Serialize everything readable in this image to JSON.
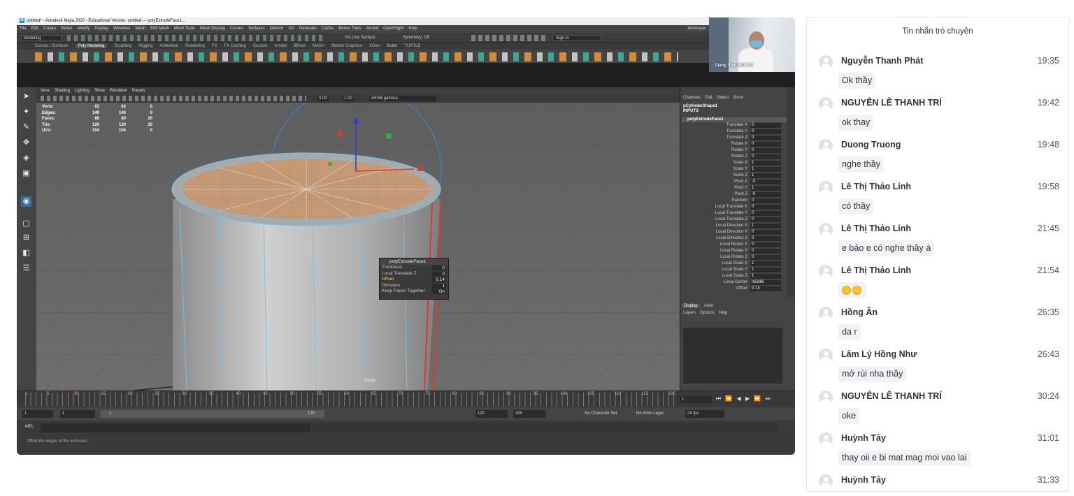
{
  "maya": {
    "title": "untitled* - Autodesk Maya 2020 - Educational Version: untitled  ---  polyExtrudeFace1...",
    "menus": [
      "File",
      "Edit",
      "Create",
      "Select",
      "Modify",
      "Display",
      "Windows",
      "Mesh",
      "Edit Mesh",
      "Mesh Tools",
      "Mesh Display",
      "Curves",
      "Surfaces",
      "Deform",
      "UV",
      "Generate",
      "Cache",
      "Bonus Tools",
      "Arnold",
      "OpenFlight",
      "Help"
    ],
    "workspace_label": "Workspac",
    "mode": "Modeling",
    "no_live_surface": "No Live Surface",
    "symmetry": "Symmetry: Off",
    "sign_in": "Sign In",
    "shelf_tabs": [
      "Curves / Surfaces",
      "Poly Modeling",
      "Sculpting",
      "Rigging",
      "Animation",
      "Rendering",
      "FX",
      "FX Caching",
      "Custom",
      "Arnold",
      "Bifrost",
      "MASH",
      "Motion Graphics",
      "XGen",
      "Bullet",
      "TURTLE"
    ],
    "panel_menus": [
      "View",
      "Shading",
      "Lighting",
      "Show",
      "Renderer",
      "Panels"
    ],
    "exposure": "0.00",
    "gamma_value": "1.00",
    "color_space": "sRGB gamma",
    "hud": [
      {
        "label": "Verts:",
        "a": "62",
        "b": "62",
        "c": "0"
      },
      {
        "label": "Edges:",
        "a": "140",
        "b": "140",
        "c": "0"
      },
      {
        "label": "Faces:",
        "a": "80",
        "b": "80",
        "c": "20"
      },
      {
        "label": "Tris:",
        "a": "120",
        "b": "120",
        "c": "20"
      },
      {
        "label": "UVs:",
        "a": "104",
        "b": "104",
        "c": "0"
      }
    ],
    "camera": "persp",
    "tool_box": {
      "title": "polyExtrudeFace1",
      "rows": [
        {
          "label": "Thickness",
          "value": "0"
        },
        {
          "label": "Local Translate Z",
          "value": "0"
        },
        {
          "label": "Offset",
          "value": "0.14"
        },
        {
          "label": "Divisions",
          "value": "1"
        },
        {
          "label": "Keep Faces Together",
          "value": "On"
        }
      ]
    },
    "channel_box": {
      "menus": [
        "Channels",
        "Edit",
        "Object",
        "Show"
      ],
      "shape": "pCylinderShape1",
      "inputs_label": "INPUTS",
      "node": "polyExtrudeFace1",
      "attributes": [
        {
          "name": "Translate X",
          "value": "0"
        },
        {
          "name": "Translate Y",
          "value": "0"
        },
        {
          "name": "Translate Z",
          "value": "0"
        },
        {
          "name": "Rotate X",
          "value": "0"
        },
        {
          "name": "Rotate Y",
          "value": "0"
        },
        {
          "name": "Rotate Z",
          "value": "0"
        },
        {
          "name": "Scale X",
          "value": "1"
        },
        {
          "name": "Scale Y",
          "value": "1"
        },
        {
          "name": "Scale Z",
          "value": "1"
        },
        {
          "name": "Pivot X",
          "value": "-0"
        },
        {
          "name": "Pivot Y",
          "value": "1"
        },
        {
          "name": "Pivot Z",
          "value": "-0"
        },
        {
          "name": "Random",
          "value": "0"
        },
        {
          "name": "Local Translate X",
          "value": "0"
        },
        {
          "name": "Local Translate Y",
          "value": "0"
        },
        {
          "name": "Local Translate Z",
          "value": "0"
        },
        {
          "name": "Local Direction X",
          "value": "1"
        },
        {
          "name": "Local Direction Y",
          "value": "0"
        },
        {
          "name": "Local Direction Z",
          "value": "0"
        },
        {
          "name": "Local Rotate X",
          "value": "0"
        },
        {
          "name": "Local Rotate Y",
          "value": "0"
        },
        {
          "name": "Local Rotate Z",
          "value": "0"
        },
        {
          "name": "Local Scale X",
          "value": "1"
        },
        {
          "name": "Local Scale Y",
          "value": "1"
        },
        {
          "name": "Local Scale Z",
          "value": "1"
        },
        {
          "name": "Local Center",
          "value": "middle"
        },
        {
          "name": "Offset",
          "value": "0.14"
        }
      ],
      "layer_tabs": [
        "Display",
        "Anim"
      ],
      "layer_menus": [
        "Layers",
        "Options",
        "Help"
      ]
    },
    "timeline_ticks": [
      "1",
      "5",
      "10",
      "15",
      "20",
      "25",
      "30",
      "35",
      "40",
      "45",
      "50",
      "55",
      "60",
      "65",
      "70",
      "75",
      "80",
      "85",
      "90",
      "95",
      "100",
      "105",
      "110",
      "115",
      "120"
    ],
    "current_frame": "1",
    "range": {
      "start": "1",
      "inner_start": "1",
      "slider_start": "1",
      "slider_end": "120",
      "inner_end": "120",
      "end": "200"
    },
    "no_character_set": "No Character Set",
    "no_anim_layer": "No Anim Layer",
    "fps": "24 fps",
    "mel_label": "MEL",
    "help_line": "Offset the edges of the extrusion.",
    "webcam_label": "Giang Vien HCM 02"
  },
  "chat": {
    "title": "Tin nhắn trò chuyện",
    "messages": [
      {
        "sender": "Nguyễn Thanh Phát",
        "time": "19:35",
        "text": "Ok thầy"
      },
      {
        "sender": "NGUYỄN LÊ THANH TRÍ",
        "time": "19:42",
        "text": "ok thay"
      },
      {
        "sender": "Duong Truong",
        "time": "19:48",
        "text": "nghe thầy"
      },
      {
        "sender": "Lê Thị Thảo Linh",
        "time": "19:58",
        "text": "có thầy"
      },
      {
        "sender": "Lê Thị Thảo Linh",
        "time": "21:45",
        "text": "e bảo e có nghe thầy á"
      },
      {
        "sender": "Lê Thị Thảo Linh",
        "time": "21:54",
        "text": "",
        "emoji_count": 2
      },
      {
        "sender": "Hồng Ân",
        "time": "26:35",
        "text": "da r"
      },
      {
        "sender": "Lâm Lý Hồng Như",
        "time": "26:43",
        "text": "mở rùi nha thầy"
      },
      {
        "sender": "NGUYỄN LÊ THANH TRÍ",
        "time": "30:24",
        "text": "oke"
      },
      {
        "sender": "Huỳnh Tây",
        "time": "31:01",
        "text": "thay oii e bi mat mag moi vao lai"
      },
      {
        "sender": "Huỳnh Tây",
        "time": "31:33",
        "text": ""
      }
    ]
  }
}
